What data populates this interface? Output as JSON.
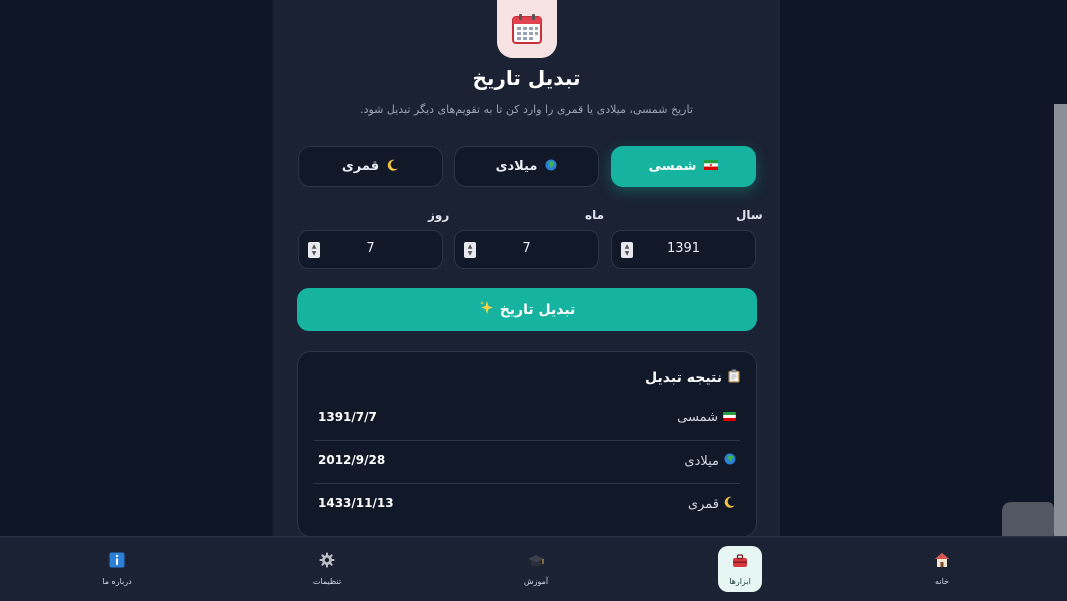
{
  "header": {
    "title": "تبدیل تاریخ",
    "subtitle": "تاریخ شمسی، میلادی یا قمری را وارد کن تا به تقویم‌های دیگر تبدیل شود.",
    "app_icon": "calendar-icon"
  },
  "calendar_selector": [
    {
      "label": "شمسی",
      "icon": "iran-flag-icon",
      "active": true
    },
    {
      "label": "میلادی",
      "icon": "globe-icon",
      "active": false
    },
    {
      "label": "قمری",
      "icon": "crescent-moon-icon",
      "active": false
    }
  ],
  "fields": {
    "year": {
      "label": "سال",
      "value": "1391"
    },
    "month": {
      "label": "ماه",
      "value": "7"
    },
    "day": {
      "label": "روز",
      "value": "7"
    }
  },
  "convert_button": {
    "label": "تبدیل تاریخ",
    "icon": "sparkles-icon"
  },
  "result": {
    "title": "نتیجه تبدیل",
    "icon": "clipboard-icon",
    "rows": [
      {
        "label": "شمسی",
        "icon": "iran-flag-icon",
        "value": "1391/7/7"
      },
      {
        "label": "میلادی",
        "icon": "globe-icon",
        "value": "2012/9/28"
      },
      {
        "label": "قمری",
        "icon": "crescent-moon-icon",
        "value": "1433/11/13"
      }
    ]
  },
  "bottom_nav": [
    {
      "label": "خانه",
      "icon": "home-icon",
      "active": false
    },
    {
      "label": "ابزارها",
      "icon": "toolbox-icon",
      "active": true
    },
    {
      "label": "آموزش",
      "icon": "graduation-cap-icon",
      "active": false
    },
    {
      "label": "تنظیمات",
      "icon": "gear-icon",
      "active": false
    },
    {
      "label": "درباره ما",
      "icon": "info-icon",
      "active": false
    }
  ],
  "colors": {
    "accent": "#16b3a0",
    "background": "#0f1627",
    "panel": "#1a2233",
    "card": "#111827"
  }
}
